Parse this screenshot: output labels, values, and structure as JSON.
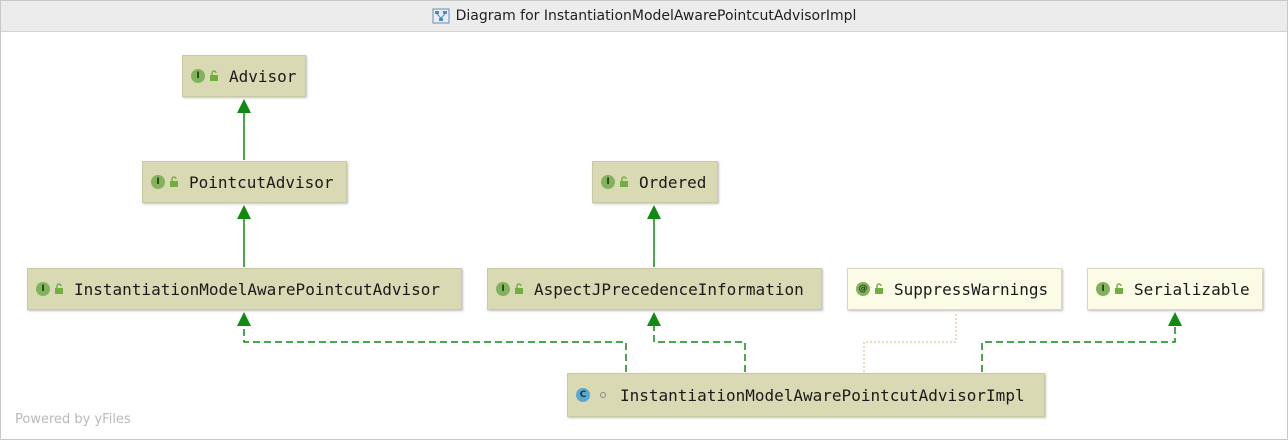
{
  "window": {
    "title": "Diagram for InstantiationModelAwarePointcutAdvisorImpl",
    "title_icon": "diagram-icon"
  },
  "diagram": {
    "nodes": {
      "advisor": {
        "label": "Advisor",
        "kind": "I",
        "icon": "interface-icon"
      },
      "pointcut_advisor": {
        "label": "PointcutAdvisor",
        "kind": "I",
        "icon": "interface-icon"
      },
      "ordered": {
        "label": "Ordered",
        "kind": "I",
        "icon": "interface-icon"
      },
      "instantiation_advisor": {
        "label": "InstantiationModelAwarePointcutAdvisor",
        "kind": "I",
        "icon": "interface-icon"
      },
      "aspectj_precedence": {
        "label": "AspectJPrecedenceInformation",
        "kind": "I",
        "icon": "interface-icon"
      },
      "suppress_warnings": {
        "label": "SuppressWarnings",
        "kind": "@",
        "icon": "annotation-icon"
      },
      "serializable": {
        "label": "Serializable",
        "kind": "I",
        "icon": "interface-icon"
      },
      "impl": {
        "label": "InstantiationModelAwarePointcutAdvisorImpl",
        "kind": "C",
        "icon": "class-icon"
      }
    },
    "edges": [
      {
        "from": "pointcut_advisor",
        "to": "advisor",
        "type": "extends"
      },
      {
        "from": "instantiation_advisor",
        "to": "pointcut_advisor",
        "type": "extends"
      },
      {
        "from": "aspectj_precedence",
        "to": "ordered",
        "type": "extends"
      },
      {
        "from": "impl",
        "to": "instantiation_advisor",
        "type": "implements"
      },
      {
        "from": "impl",
        "to": "aspectj_precedence",
        "type": "implements"
      },
      {
        "from": "impl",
        "to": "suppress_warnings",
        "type": "annotated-with"
      },
      {
        "from": "impl",
        "to": "serializable",
        "type": "implements"
      }
    ],
    "colors": {
      "edge": "#108a10",
      "annotation_edge": "#d6b98a",
      "node_fill": "#d9d9b4",
      "external_node_fill": "#fbfbe6"
    }
  },
  "footer": {
    "text": "Powered by yFiles"
  }
}
